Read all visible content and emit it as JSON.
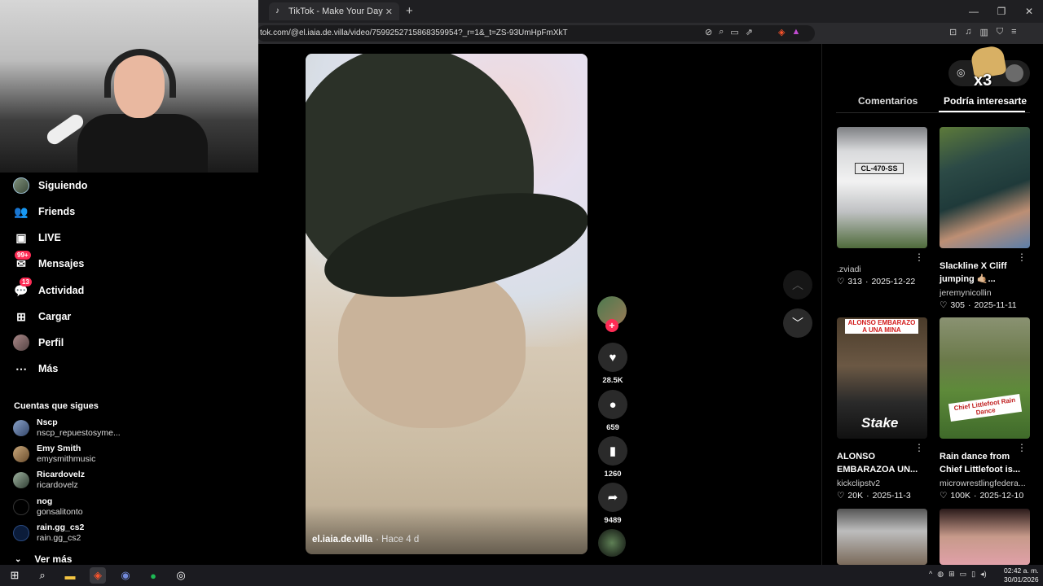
{
  "browser": {
    "tab_title": "TikTok - Make Your Day",
    "url": "tok.com/@el.iaia.de.villa/video/7599252715868359954?_r=1&_t=ZS-93UmHpFmXkT"
  },
  "sidebar": {
    "nav": [
      {
        "label": "Siguiendo",
        "icon": "following-avatar-icon"
      },
      {
        "label": "Friends",
        "icon": "friends-icon"
      },
      {
        "label": "LIVE",
        "icon": "live-icon"
      },
      {
        "label": "Mensajes",
        "icon": "messages-icon",
        "badge": "99+"
      },
      {
        "label": "Actividad",
        "icon": "activity-icon",
        "badge": "13"
      },
      {
        "label": "Cargar",
        "icon": "upload-icon"
      },
      {
        "label": "Perfil",
        "icon": "profile-avatar-icon"
      },
      {
        "label": "Más",
        "icon": "more-icon"
      }
    ],
    "following_title": "Cuentas que sigues",
    "accounts": [
      {
        "name": "Nscp",
        "handle": "nscp_repuestosyme..."
      },
      {
        "name": "Emy Smith",
        "handle": "emysmithmusic"
      },
      {
        "name": "Ricardovelz",
        "handle": "ricardovelz"
      },
      {
        "name": "nog",
        "handle": "gonsalitonto"
      },
      {
        "name": "rain.gg_cs2",
        "handle": "rain.gg_cs2"
      }
    ],
    "see_more": "Ver más"
  },
  "video": {
    "username": "el.iaia.de.villa",
    "time": "· Hace 4 d"
  },
  "actions": {
    "likes": "28.5K",
    "comments": "659",
    "saves": "1260",
    "shares": "9489"
  },
  "right_panel": {
    "emote_text": "x3",
    "tabs": [
      "Comentarios",
      "Podría interesarte"
    ],
    "active_tab": 1,
    "cards": [
      {
        "title": "",
        "author": ".zviadi",
        "likes": "313",
        "date": "2025-12-22",
        "plate": "CL-470-SS"
      },
      {
        "title": "Slackline X Cliff jumping 🤙🏼...",
        "author": "jeremynicollin",
        "likes": "305",
        "date": "2025-11-11"
      },
      {
        "title": "ALONSO EMBARAZOA UN...",
        "author": "kickclipstv2",
        "likes": "20K",
        "date": "2025-11-3",
        "tag": "ALONSO EMBARAZO A UNA MINA",
        "overlay": "Stake"
      },
      {
        "title": "Rain dance from Chief Littlefoot is...",
        "author": "microwrestlingfedera...",
        "likes": "100K",
        "date": "2025-12-10",
        "tag": "Chief Littlefoot Rain Dance"
      },
      {
        "title": "",
        "author": "",
        "likes": "",
        "date": ""
      },
      {
        "title": "",
        "author": "",
        "likes": "",
        "date": ""
      }
    ]
  },
  "taskbar": {
    "time": "02:42 a. m.",
    "date": "30/01/2026"
  },
  "colors": {
    "accent": "#fe2c55",
    "background": "#000000"
  }
}
